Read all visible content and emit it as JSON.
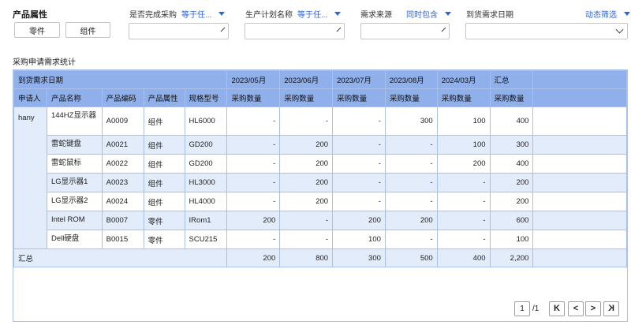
{
  "filters": {
    "product_attr": {
      "label": "产品属性",
      "btn1": "零件",
      "btn2": "组件"
    },
    "is_purchase_done": {
      "label": "是否完成采购",
      "op": "等于任..."
    },
    "plan_name": {
      "label": "生产计划名称",
      "op": "等于任..."
    },
    "demand_source": {
      "label": "需求来源",
      "op": "同时包含"
    },
    "arrival_date": {
      "label": "到货需求日期"
    },
    "dynamic": "动态筛选"
  },
  "section_title": "采购申请需求统计",
  "table": {
    "group_header": "到货需求日期",
    "date_cols": [
      "2023/05月",
      "2023/06月",
      "2023/07月",
      "2023/08月",
      "2024/03月"
    ],
    "total_col": "汇总",
    "headers": [
      "申请人",
      "产品名称",
      "产品编码",
      "产品属性",
      "规格型号"
    ],
    "qty_label": "采购数量",
    "applicant": "hany",
    "rows": [
      {
        "name": "144HZ显示器",
        "code": "A0009",
        "attr": "组件",
        "model": "HL6000",
        "vals": [
          "-",
          "-",
          "-",
          "300",
          "100"
        ],
        "total": "400"
      },
      {
        "name": "雷蛇键盘",
        "code": "A0021",
        "attr": "组件",
        "model": "GD200",
        "vals": [
          "-",
          "200",
          "-",
          "-",
          "100"
        ],
        "total": "300"
      },
      {
        "name": "雷蛇鼠标",
        "code": "A0022",
        "attr": "组件",
        "model": "GD200",
        "vals": [
          "-",
          "200",
          "-",
          "-",
          "200"
        ],
        "total": "400"
      },
      {
        "name": "LG显示器1",
        "code": "A0023",
        "attr": "组件",
        "model": "HL3000",
        "vals": [
          "-",
          "200",
          "-",
          "-",
          "-"
        ],
        "total": "200"
      },
      {
        "name": "LG显示器2",
        "code": "A0024",
        "attr": "组件",
        "model": "HL4000",
        "vals": [
          "-",
          "200",
          "-",
          "-",
          "-"
        ],
        "total": "200"
      },
      {
        "name": "Intel ROM",
        "code": "B0007",
        "attr": "零件",
        "model": "IRom1",
        "vals": [
          "200",
          "-",
          "200",
          "200",
          "-"
        ],
        "total": "600"
      },
      {
        "name": "Dell硬盘",
        "code": "B0015",
        "attr": "零件",
        "model": "SCU215",
        "vals": [
          "-",
          "-",
          "100",
          "-",
          "-"
        ],
        "total": "100"
      }
    ],
    "summary": {
      "label": "汇总",
      "vals": [
        "200",
        "800",
        "300",
        "500",
        "400"
      ],
      "total": "2,200"
    }
  },
  "pager": {
    "page": "1",
    "sep": "/",
    "total": "1",
    "first": "K",
    "prev": "<",
    "next": ">",
    "last": "K"
  },
  "colors": {
    "header": "#8fb0ea",
    "stripe": "#e3ecfb",
    "border": "#a9c1ea",
    "accent": "#2f63d6"
  }
}
